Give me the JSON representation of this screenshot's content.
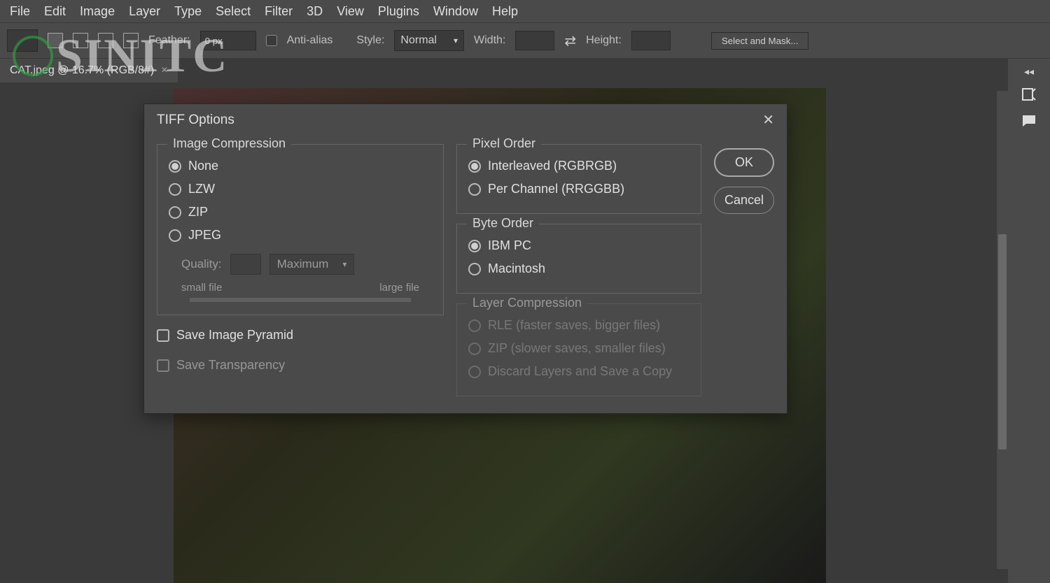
{
  "menu": [
    "File",
    "Edit",
    "Image",
    "Layer",
    "Type",
    "Select",
    "Filter",
    "3D",
    "View",
    "Plugins",
    "Window",
    "Help"
  ],
  "optionsBar": {
    "featherLabel": "Feather:",
    "featherValue": "0 px",
    "antiAlias": "Anti-alias",
    "styleLabel": "Style:",
    "styleValue": "Normal",
    "widthLabel": "Width:",
    "heightLabel": "Height:",
    "selectMask": "Select and Mask..."
  },
  "docTab": "CAT.jpeg @ 16.7% (RGB/8#)",
  "watermark": "SINITC",
  "dialog": {
    "title": "TIFF Options",
    "imageCompression": {
      "legend": "Image Compression",
      "none": "None",
      "lzw": "LZW",
      "zip": "ZIP",
      "jpeg": "JPEG",
      "qualityLabel": "Quality:",
      "qualityPreset": "Maximum",
      "smallFile": "small file",
      "largeFile": "large file"
    },
    "saveImagePyramid": "Save Image Pyramid",
    "saveTransparency": "Save Transparency",
    "pixelOrder": {
      "legend": "Pixel Order",
      "interleaved": "Interleaved (RGBRGB)",
      "perChannel": "Per Channel (RRGGBB)"
    },
    "byteOrder": {
      "legend": "Byte Order",
      "ibm": "IBM PC",
      "mac": "Macintosh"
    },
    "layerCompression": {
      "legend": "Layer Compression",
      "rle": "RLE (faster saves, bigger files)",
      "zip": "ZIP (slower saves, smaller files)",
      "discard": "Discard Layers and Save a Copy"
    },
    "ok": "OK",
    "cancel": "Cancel"
  }
}
